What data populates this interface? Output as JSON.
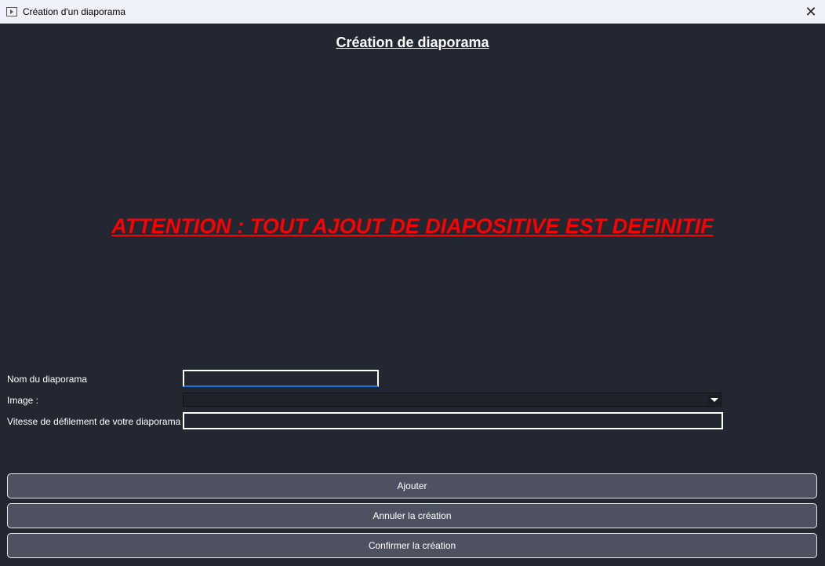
{
  "window": {
    "title": "Création d'un diaporama",
    "close": "✕"
  },
  "heading": "Création de diaporama",
  "warning": "ATTENTION : TOUT AJOUT DE DIAPOSITIVE EST DEFINITIF",
  "colors": {
    "warning": "#ff0000",
    "background": "#222732",
    "button": "#4e5260"
  },
  "form": {
    "name_label": "Nom du diaporama",
    "name_value": "",
    "image_label": "Image :",
    "image_value": "",
    "speed_label": "Vitesse de défilement de votre diaporama",
    "speed_value": ""
  },
  "buttons": {
    "add": "Ajouter",
    "cancel": "Annuler la création",
    "confirm": "Confirmer la création"
  }
}
